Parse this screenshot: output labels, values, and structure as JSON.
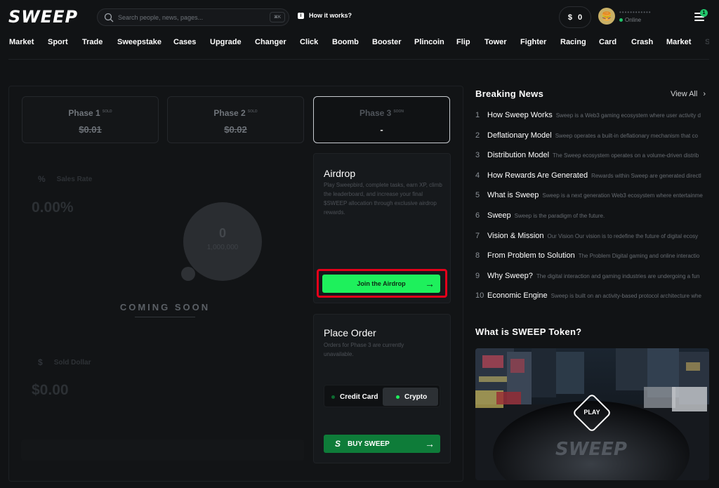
{
  "header": {
    "logo": "SWEEP",
    "search_placeholder": "Search people, news, pages...",
    "search_kbd": "⌘K",
    "how_it_works": "How it works?",
    "balance_symbol": "$",
    "balance_value": "0",
    "profile_name": "••••••••••••",
    "profile_status": "Online",
    "notification_count": "1"
  },
  "nav": [
    "Market",
    "Sport",
    "Trade",
    "Sweepstake",
    "Cases",
    "Upgrade",
    "Changer",
    "Click",
    "Boomb",
    "Booster",
    "Plincoin",
    "Flip",
    "Tower",
    "Fighter",
    "Racing",
    "Card",
    "Crash",
    "Market",
    "S"
  ],
  "phases": [
    {
      "label": "Phase 1",
      "tag": "SOLD",
      "price": "$0.01"
    },
    {
      "label": "Phase 2",
      "tag": "SOLD",
      "price": "$0.02"
    },
    {
      "label": "Phase 3",
      "tag": "SOON",
      "price": "-"
    }
  ],
  "stats": {
    "sales_rate_label": "Sales Rate",
    "sales_rate_symbol": "%",
    "sales_rate_value": "0.00%",
    "circle_value": "0",
    "circle_total": "1,000,000",
    "coming_soon": "COMING SOON",
    "sold_dollar_label": "Sold Dollar",
    "sold_dollar_symbol": "$",
    "sold_dollar_value": "$0.00"
  },
  "airdrop": {
    "title": "Airdrop",
    "description": "Play Sweepbird, complete tasks, earn XP, climb the leaderboard, and increase your final $SWEEP allocation through exclusive airdrop rewards.",
    "button": "Join the Airdrop"
  },
  "order": {
    "title": "Place Order",
    "description": "Orders for Phase 3 are currently unavailable.",
    "credit_card": "Credit Card",
    "crypto": "Crypto",
    "buy_button": "BUY SWEEP"
  },
  "news": {
    "title": "Breaking News",
    "view_all": "View All",
    "items": [
      {
        "n": "1",
        "title": "How Sweep Works",
        "desc": "Sweep is a Web3 gaming ecosystem where user activity d"
      },
      {
        "n": "2",
        "title": "Deflationary Model",
        "desc": "Sweep operates a built-in deflationary mechanism that co"
      },
      {
        "n": "3",
        "title": "Distribution Model",
        "desc": "The Sweep ecosystem operates on a volume-driven distrib"
      },
      {
        "n": "4",
        "title": "How Rewards Are Generated",
        "desc": "Rewards within Sweep are generated directl"
      },
      {
        "n": "5",
        "title": "What is Sweep",
        "desc": "Sweep is a next generation Web3 ecosystem where entertainme"
      },
      {
        "n": "6",
        "title": "Sweep",
        "desc": "Sweep is the paradigm of the future."
      },
      {
        "n": "7",
        "title": "Vision & Mission",
        "desc": "Our Vision Our vision is to redefine the future of digital ecosy"
      },
      {
        "n": "8",
        "title": "From Problem to Solution",
        "desc": "The Problem Digital gaming and online interactio"
      },
      {
        "n": "9",
        "title": "Why Sweep?",
        "desc": "The digital interaction and gaming industries are undergoing a fun"
      },
      {
        "n": "10",
        "title": "Economic Engine",
        "desc": "Sweep is built on an activity-based protocol architecture whe"
      }
    ]
  },
  "token": {
    "title": "What is SWEEP Token?",
    "play": "PLAY",
    "video_watermark": "SWEEP"
  },
  "colors": {
    "accent_green": "#1ef05c",
    "buy_green": "#0e7c39",
    "highlight_red": "#e4001a"
  }
}
